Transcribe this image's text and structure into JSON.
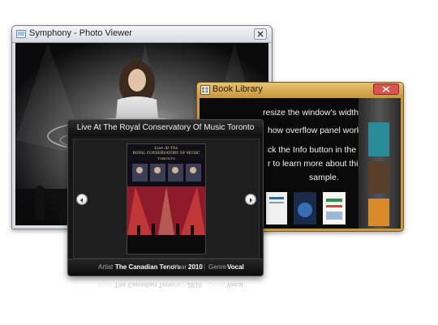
{
  "photo_viewer": {
    "title": "Symphony - Photo Viewer"
  },
  "book_library": {
    "title": "Book Library",
    "info_lines": [
      "resize the window's width",
      "how overflow panel works.",
      "ck the Info button in the",
      "r  to learn more about this",
      "sample."
    ]
  },
  "album": {
    "title": "Live At The Royal Conservatory Of Music Toronto",
    "cover_title_line1": "Live At The",
    "cover_title_line2": "ROYAL CONSERVATORY OF MUSIC",
    "cover_title_line3": "TORONTO",
    "artist_label": "Artist",
    "artist_value": "The Canadian Tenors",
    "year_label": "Year",
    "year_value": "2010",
    "genre_label": "Genre",
    "genre_value": "Vocal"
  },
  "icons": {
    "prev": "chevron-left-icon",
    "next": "chevron-right-icon",
    "close": "close-icon"
  }
}
